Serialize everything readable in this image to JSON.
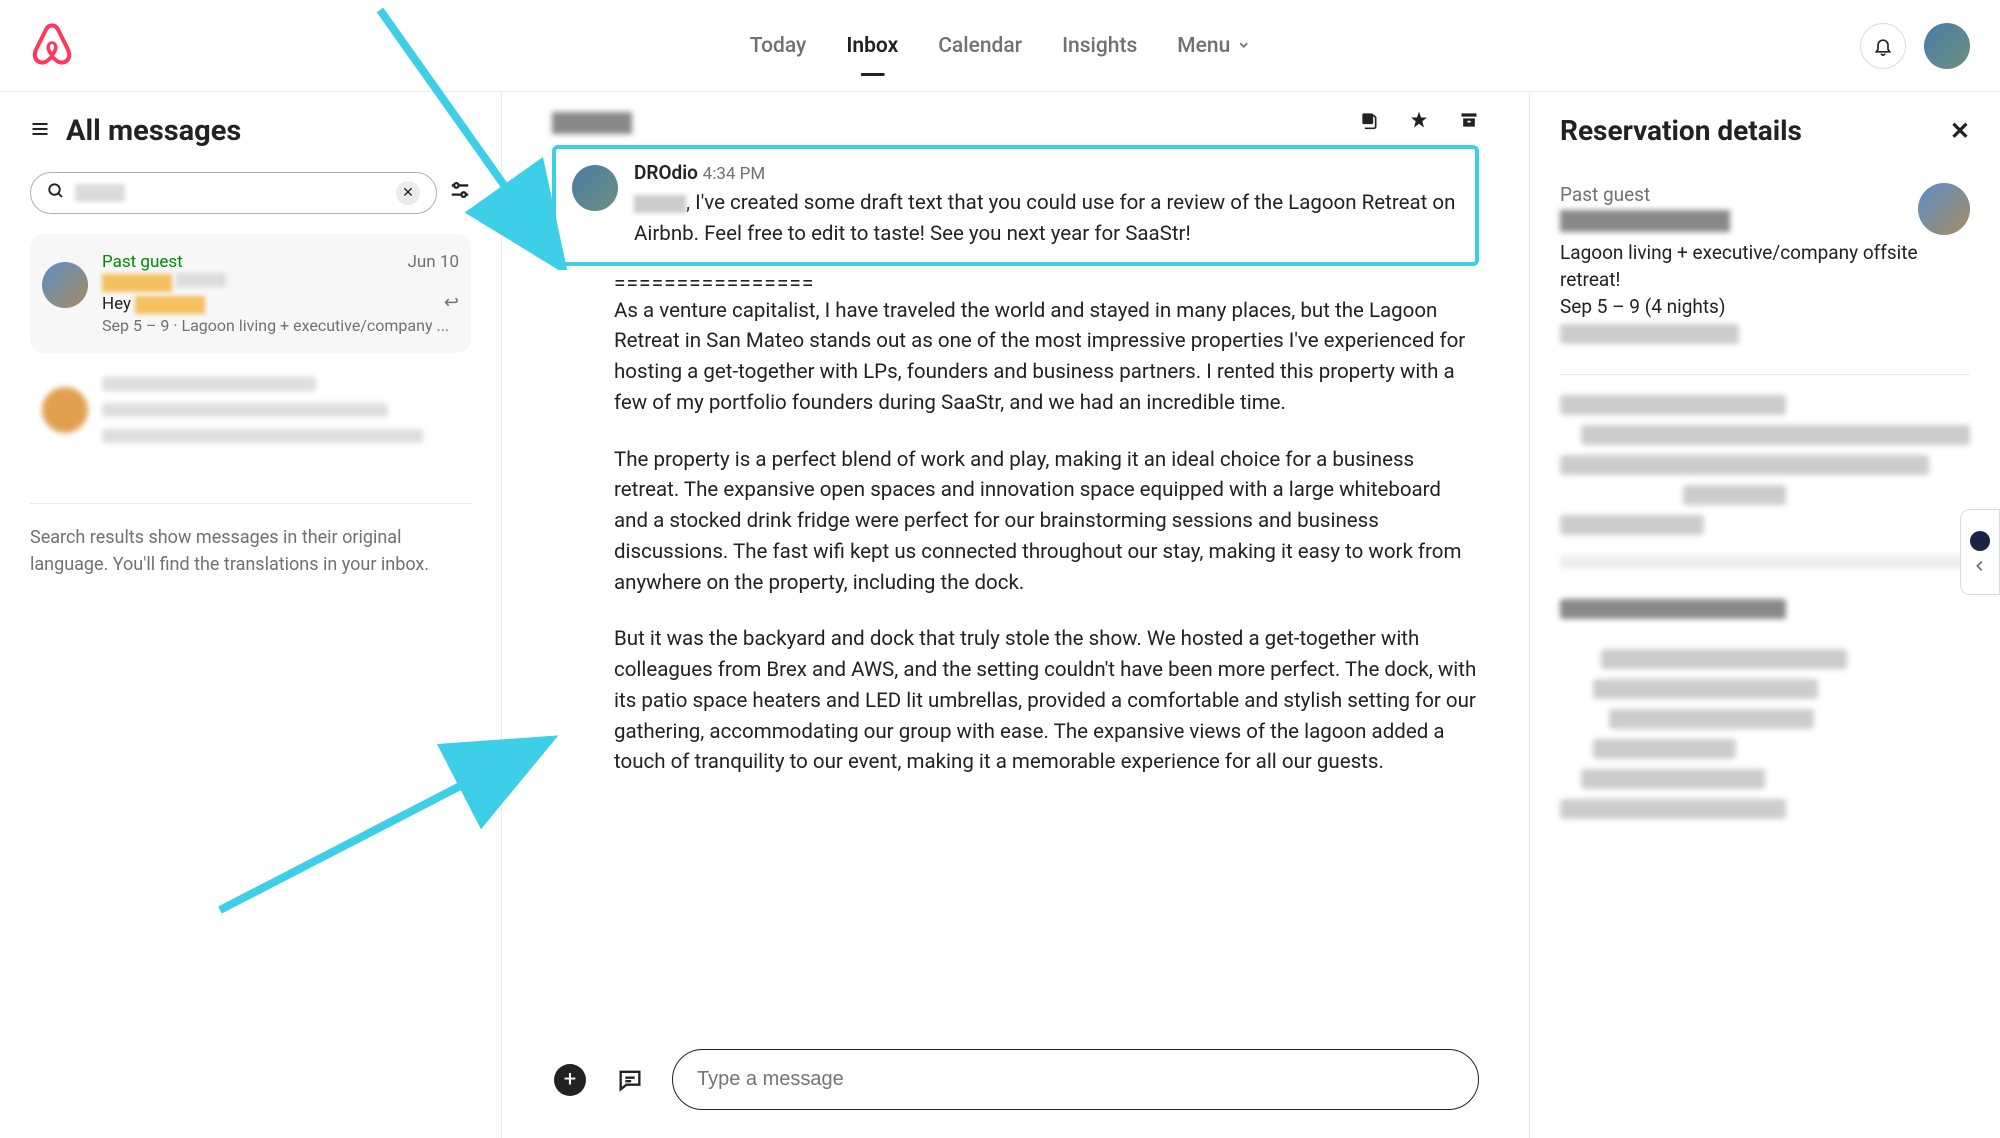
{
  "header": {
    "nav": {
      "today": "Today",
      "inbox": "Inbox",
      "calendar": "Calendar",
      "insights": "Insights",
      "menu": "Menu"
    }
  },
  "sidebar": {
    "title": "All messages",
    "searchPlaceholder": "",
    "note": "Search results show messages in their original language. You'll find the translations in your inbox.",
    "thread1": {
      "status": "Past guest",
      "date": "Jun 10",
      "preview_prefix": "Hey ",
      "meta": "Sep 5 – 9 · Lagoon living + executive/company ..."
    }
  },
  "conversation": {
    "sender": "DROdio",
    "time": "4:34 PM",
    "intro": ", I've created some draft text that you could use for a review of the Lagoon Retreat on Airbnb. Feel free to edit to taste! See you next year for SaaStr!",
    "separator": "================",
    "para1": "As a venture capitalist, I have traveled the world and stayed in many places, but the Lagoon Retreat in San Mateo stands out as one of the most impressive properties I've experienced for hosting a get-together with LPs, founders and business partners. I rented this property with a few of my portfolio founders during SaaStr, and we had an incredible time.",
    "para2": "The property is a perfect blend of work and play, making it an ideal choice for a business retreat. The expansive open spaces and innovation space equipped with a large whiteboard and a stocked drink fridge were perfect for our brainstorming sessions and business discussions. The fast wifi kept us connected throughout our stay, making it easy to work from anywhere on the property, including the dock.",
    "para3": "But it was the backyard and dock that truly stole the show. We hosted a get-together with colleagues from Brex and AWS, and the setting couldn't have been more perfect. The dock, with its patio space heaters and LED lit umbrellas, provided a comfortable and stylish setting for our gathering, accommodating our group with ease. The expansive views of the lagoon added a touch of tranquility to our event, making it a memorable experience for all our guests.",
    "composePlaceholder": "Type a message"
  },
  "rightPanel": {
    "title": "Reservation details",
    "guestLabel": "Past guest",
    "listing": "Lagoon living + executive/company offsite retreat!",
    "dates": "Sep 5 – 9 (4 nights)"
  }
}
